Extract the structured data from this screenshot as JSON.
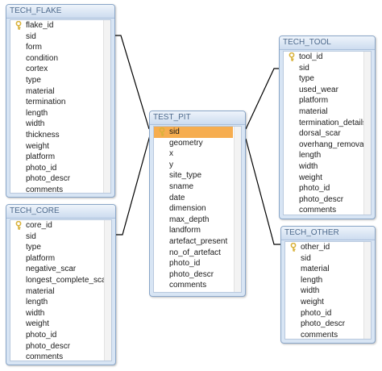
{
  "tables": {
    "flake": {
      "title": "TECH_FLAKE",
      "fields": [
        "flake_id",
        "sid",
        "form",
        "condition",
        "cortex",
        "type",
        "material",
        "termination",
        "length",
        "width",
        "thickness",
        "weight",
        "platform",
        "photo_id",
        "photo_descr",
        "comments"
      ]
    },
    "core": {
      "title": "TECH_CORE",
      "fields": [
        "core_id",
        "sid",
        "type",
        "platform",
        "negative_scar",
        "longest_complete_scar",
        "material",
        "length",
        "width",
        "weight",
        "photo_id",
        "photo_descr",
        "comments"
      ]
    },
    "pit": {
      "title": "TEST_PIT",
      "fields": [
        "sid",
        "geometry",
        "x",
        "y",
        "site_type",
        "sname",
        "date",
        "dimension",
        "max_depth",
        "landform",
        "artefact_present",
        "no_of_artefact",
        "photo_id",
        "photo_descr",
        "comments"
      ]
    },
    "tool": {
      "title": "TECH_TOOL",
      "fields": [
        "tool_id",
        "sid",
        "type",
        "used_wear",
        "platform",
        "material",
        "termination_details",
        "dorsal_scar",
        "overhang_removal",
        "length",
        "width",
        "weight",
        "photo_id",
        "photo_descr",
        "comments"
      ]
    },
    "other": {
      "title": "TECH_OTHER",
      "fields": [
        "other_id",
        "sid",
        "material",
        "length",
        "width",
        "weight",
        "photo_id",
        "photo_descr",
        "comments"
      ]
    }
  },
  "colors": {
    "header_text": "#4e6a8c",
    "selection": "#f6ad4f",
    "key": "#d9b23a",
    "relationship_line": "#000000"
  },
  "icons": {
    "primary_key": "key-icon"
  }
}
